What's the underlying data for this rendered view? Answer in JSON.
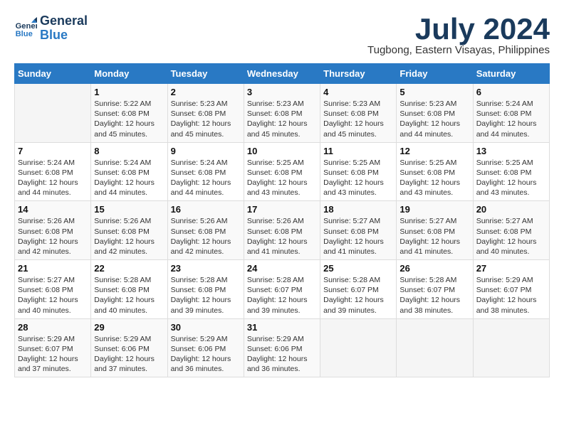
{
  "logo": {
    "line1": "General",
    "line2": "Blue"
  },
  "title": "July 2024",
  "location": "Tugbong, Eastern Visayas, Philippines",
  "headers": [
    "Sunday",
    "Monday",
    "Tuesday",
    "Wednesday",
    "Thursday",
    "Friday",
    "Saturday"
  ],
  "weeks": [
    [
      {
        "day": "",
        "sunrise": "",
        "sunset": "",
        "daylight": ""
      },
      {
        "day": "1",
        "sunrise": "Sunrise: 5:22 AM",
        "sunset": "Sunset: 6:08 PM",
        "daylight": "Daylight: 12 hours and 45 minutes."
      },
      {
        "day": "2",
        "sunrise": "Sunrise: 5:23 AM",
        "sunset": "Sunset: 6:08 PM",
        "daylight": "Daylight: 12 hours and 45 minutes."
      },
      {
        "day": "3",
        "sunrise": "Sunrise: 5:23 AM",
        "sunset": "Sunset: 6:08 PM",
        "daylight": "Daylight: 12 hours and 45 minutes."
      },
      {
        "day": "4",
        "sunrise": "Sunrise: 5:23 AM",
        "sunset": "Sunset: 6:08 PM",
        "daylight": "Daylight: 12 hours and 45 minutes."
      },
      {
        "day": "5",
        "sunrise": "Sunrise: 5:23 AM",
        "sunset": "Sunset: 6:08 PM",
        "daylight": "Daylight: 12 hours and 44 minutes."
      },
      {
        "day": "6",
        "sunrise": "Sunrise: 5:24 AM",
        "sunset": "Sunset: 6:08 PM",
        "daylight": "Daylight: 12 hours and 44 minutes."
      }
    ],
    [
      {
        "day": "7",
        "sunrise": "Sunrise: 5:24 AM",
        "sunset": "Sunset: 6:08 PM",
        "daylight": "Daylight: 12 hours and 44 minutes."
      },
      {
        "day": "8",
        "sunrise": "Sunrise: 5:24 AM",
        "sunset": "Sunset: 6:08 PM",
        "daylight": "Daylight: 12 hours and 44 minutes."
      },
      {
        "day": "9",
        "sunrise": "Sunrise: 5:24 AM",
        "sunset": "Sunset: 6:08 PM",
        "daylight": "Daylight: 12 hours and 44 minutes."
      },
      {
        "day": "10",
        "sunrise": "Sunrise: 5:25 AM",
        "sunset": "Sunset: 6:08 PM",
        "daylight": "Daylight: 12 hours and 43 minutes."
      },
      {
        "day": "11",
        "sunrise": "Sunrise: 5:25 AM",
        "sunset": "Sunset: 6:08 PM",
        "daylight": "Daylight: 12 hours and 43 minutes."
      },
      {
        "day": "12",
        "sunrise": "Sunrise: 5:25 AM",
        "sunset": "Sunset: 6:08 PM",
        "daylight": "Daylight: 12 hours and 43 minutes."
      },
      {
        "day": "13",
        "sunrise": "Sunrise: 5:25 AM",
        "sunset": "Sunset: 6:08 PM",
        "daylight": "Daylight: 12 hours and 43 minutes."
      }
    ],
    [
      {
        "day": "14",
        "sunrise": "Sunrise: 5:26 AM",
        "sunset": "Sunset: 6:08 PM",
        "daylight": "Daylight: 12 hours and 42 minutes."
      },
      {
        "day": "15",
        "sunrise": "Sunrise: 5:26 AM",
        "sunset": "Sunset: 6:08 PM",
        "daylight": "Daylight: 12 hours and 42 minutes."
      },
      {
        "day": "16",
        "sunrise": "Sunrise: 5:26 AM",
        "sunset": "Sunset: 6:08 PM",
        "daylight": "Daylight: 12 hours and 42 minutes."
      },
      {
        "day": "17",
        "sunrise": "Sunrise: 5:26 AM",
        "sunset": "Sunset: 6:08 PM",
        "daylight": "Daylight: 12 hours and 41 minutes."
      },
      {
        "day": "18",
        "sunrise": "Sunrise: 5:27 AM",
        "sunset": "Sunset: 6:08 PM",
        "daylight": "Daylight: 12 hours and 41 minutes."
      },
      {
        "day": "19",
        "sunrise": "Sunrise: 5:27 AM",
        "sunset": "Sunset: 6:08 PM",
        "daylight": "Daylight: 12 hours and 41 minutes."
      },
      {
        "day": "20",
        "sunrise": "Sunrise: 5:27 AM",
        "sunset": "Sunset: 6:08 PM",
        "daylight": "Daylight: 12 hours and 40 minutes."
      }
    ],
    [
      {
        "day": "21",
        "sunrise": "Sunrise: 5:27 AM",
        "sunset": "Sunset: 6:08 PM",
        "daylight": "Daylight: 12 hours and 40 minutes."
      },
      {
        "day": "22",
        "sunrise": "Sunrise: 5:28 AM",
        "sunset": "Sunset: 6:08 PM",
        "daylight": "Daylight: 12 hours and 40 minutes."
      },
      {
        "day": "23",
        "sunrise": "Sunrise: 5:28 AM",
        "sunset": "Sunset: 6:08 PM",
        "daylight": "Daylight: 12 hours and 39 minutes."
      },
      {
        "day": "24",
        "sunrise": "Sunrise: 5:28 AM",
        "sunset": "Sunset: 6:07 PM",
        "daylight": "Daylight: 12 hours and 39 minutes."
      },
      {
        "day": "25",
        "sunrise": "Sunrise: 5:28 AM",
        "sunset": "Sunset: 6:07 PM",
        "daylight": "Daylight: 12 hours and 39 minutes."
      },
      {
        "day": "26",
        "sunrise": "Sunrise: 5:28 AM",
        "sunset": "Sunset: 6:07 PM",
        "daylight": "Daylight: 12 hours and 38 minutes."
      },
      {
        "day": "27",
        "sunrise": "Sunrise: 5:29 AM",
        "sunset": "Sunset: 6:07 PM",
        "daylight": "Daylight: 12 hours and 38 minutes."
      }
    ],
    [
      {
        "day": "28",
        "sunrise": "Sunrise: 5:29 AM",
        "sunset": "Sunset: 6:07 PM",
        "daylight": "Daylight: 12 hours and 37 minutes."
      },
      {
        "day": "29",
        "sunrise": "Sunrise: 5:29 AM",
        "sunset": "Sunset: 6:06 PM",
        "daylight": "Daylight: 12 hours and 37 minutes."
      },
      {
        "day": "30",
        "sunrise": "Sunrise: 5:29 AM",
        "sunset": "Sunset: 6:06 PM",
        "daylight": "Daylight: 12 hours and 36 minutes."
      },
      {
        "day": "31",
        "sunrise": "Sunrise: 5:29 AM",
        "sunset": "Sunset: 6:06 PM",
        "daylight": "Daylight: 12 hours and 36 minutes."
      },
      {
        "day": "",
        "sunrise": "",
        "sunset": "",
        "daylight": ""
      },
      {
        "day": "",
        "sunrise": "",
        "sunset": "",
        "daylight": ""
      },
      {
        "day": "",
        "sunrise": "",
        "sunset": "",
        "daylight": ""
      }
    ]
  ]
}
